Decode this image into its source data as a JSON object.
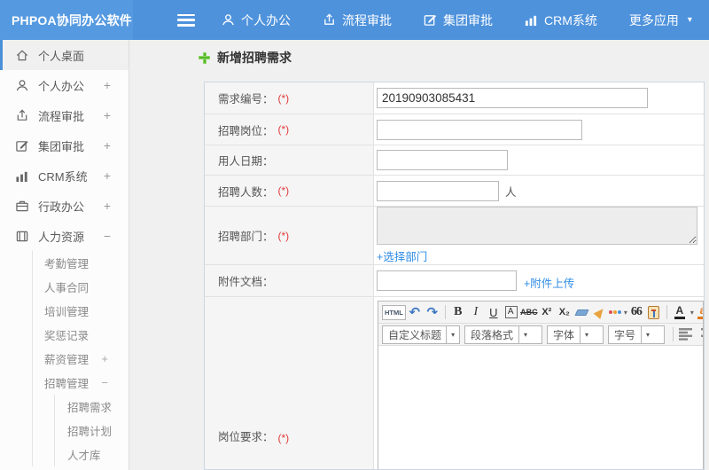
{
  "topbar": {
    "logo": "PHPOA协同办公软件",
    "menu": [
      {
        "label": "个人办公"
      },
      {
        "label": "流程审批"
      },
      {
        "label": "集团审批"
      },
      {
        "label": "CRM系统"
      },
      {
        "label": "更多应用",
        "caret": "▾"
      }
    ]
  },
  "sidebar": {
    "items": [
      {
        "label": "个人桌面"
      },
      {
        "label": "个人办公",
        "toggle": "+"
      },
      {
        "label": "流程审批",
        "toggle": "+"
      },
      {
        "label": "集团审批",
        "toggle": "+"
      },
      {
        "label": "CRM系统",
        "toggle": "+"
      },
      {
        "label": "行政办公",
        "toggle": "+"
      },
      {
        "label": "人力资源",
        "toggle": "−"
      }
    ],
    "hr_sub": [
      {
        "label": "考勤管理"
      },
      {
        "label": "人事合同"
      },
      {
        "label": "培训管理"
      },
      {
        "label": "奖惩记录"
      },
      {
        "label": "薪资管理",
        "toggle": "+"
      },
      {
        "label": "招聘管理",
        "toggle": "−"
      }
    ],
    "recruit_sub": [
      {
        "label": "招聘需求"
      },
      {
        "label": "招聘计划"
      },
      {
        "label": "人才库"
      }
    ]
  },
  "main": {
    "title": "新增招聘需求",
    "form": {
      "rows": [
        {
          "label": "需求编号：",
          "required": "(*)",
          "value": "20190903085431"
        },
        {
          "label": "招聘岗位：",
          "required": "(*)"
        },
        {
          "label": "用人日期："
        },
        {
          "label": "招聘人数：",
          "required": "(*)",
          "suffix": "人"
        },
        {
          "label": "招聘部门：",
          "required": "(*)",
          "link": "+选择部门"
        },
        {
          "label": "附件文档：",
          "link": "+附件上传"
        },
        {
          "label": "岗位要求：",
          "required": "(*)"
        }
      ]
    },
    "editor": {
      "source_button": "HTML",
      "bold": "B",
      "italic": "I",
      "underline": "U",
      "char_border": "A",
      "strikethrough": "ABC",
      "superscript": "X²",
      "subscript": "X₂",
      "blockquote": "66",
      "font_color_letter": "A",
      "back_color_letter": "a",
      "heading_select": "自定义标题",
      "paragraph_select": "段落格式",
      "font_select": "字体",
      "size_select": "字号"
    }
  },
  "icons": {
    "undo": "↶",
    "redo": "↷",
    "caret_down": "▾"
  },
  "colors": {
    "topbar": "#4e92dc",
    "logo_bg": "#5599e0",
    "accent": "#4a90d9",
    "link": "#2e8ce6",
    "required": "#e23b3b",
    "title_plus": "#57b52e"
  }
}
